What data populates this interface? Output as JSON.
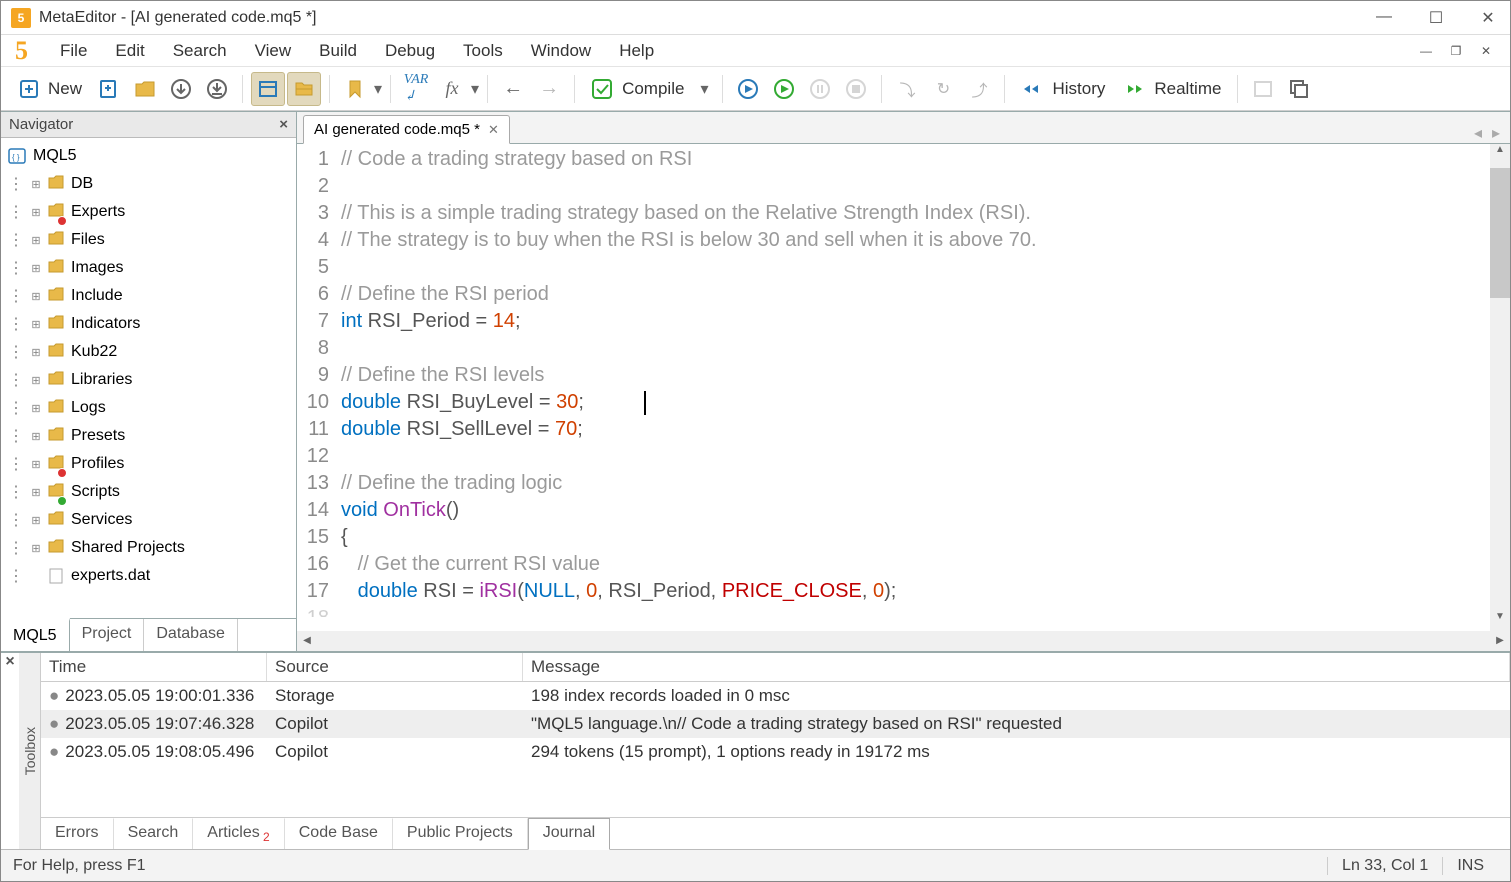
{
  "window": {
    "title": "MetaEditor - [AI generated code.mq5 *]"
  },
  "menu": {
    "items": [
      "File",
      "Edit",
      "Search",
      "View",
      "Build",
      "Debug",
      "Tools",
      "Window",
      "Help"
    ]
  },
  "toolbar": {
    "new_label": "New",
    "compile_label": "Compile",
    "history_label": "History",
    "realtime_label": "Realtime"
  },
  "navigator": {
    "title": "Navigator",
    "root": "MQL5",
    "items": [
      {
        "label": "DB",
        "overlay": ""
      },
      {
        "label": "Experts",
        "overlay": "red"
      },
      {
        "label": "Files",
        "overlay": ""
      },
      {
        "label": "Images",
        "overlay": ""
      },
      {
        "label": "Include",
        "overlay": ""
      },
      {
        "label": "Indicators",
        "overlay": ""
      },
      {
        "label": "Kub22",
        "overlay": ""
      },
      {
        "label": "Libraries",
        "overlay": ""
      },
      {
        "label": "Logs",
        "overlay": ""
      },
      {
        "label": "Presets",
        "overlay": ""
      },
      {
        "label": "Profiles",
        "overlay": "red"
      },
      {
        "label": "Scripts",
        "overlay": "green"
      },
      {
        "label": "Services",
        "overlay": ""
      },
      {
        "label": "Shared Projects",
        "overlay": ""
      }
    ],
    "file": "experts.dat",
    "tabs": [
      "MQL5",
      "Project",
      "Database"
    ],
    "active_tab": 0
  },
  "editor": {
    "tab_label": "AI generated code.mq5 *",
    "lines": [
      {
        "n": 1,
        "tokens": [
          {
            "t": "// Code a trading strategy based on RSI",
            "c": "cm"
          }
        ]
      },
      {
        "n": 2,
        "tokens": []
      },
      {
        "n": 3,
        "tokens": [
          {
            "t": "// This is a simple trading strategy based on the Relative Strength Index (RSI).",
            "c": "cm"
          }
        ]
      },
      {
        "n": 4,
        "tokens": [
          {
            "t": "// The strategy is to buy when the RSI is below 30 and sell when it is above 70.",
            "c": "cm"
          }
        ]
      },
      {
        "n": 5,
        "tokens": []
      },
      {
        "n": 6,
        "tokens": [
          {
            "t": "// Define the RSI period",
            "c": "cm"
          }
        ]
      },
      {
        "n": 7,
        "tokens": [
          {
            "t": "int",
            "c": "kw"
          },
          {
            "t": " RSI_Period = ",
            "c": ""
          },
          {
            "t": "14",
            "c": "num"
          },
          {
            "t": ";",
            "c": ""
          }
        ]
      },
      {
        "n": 8,
        "tokens": []
      },
      {
        "n": 9,
        "tokens": [
          {
            "t": "// Define the RSI levels",
            "c": "cm"
          }
        ]
      },
      {
        "n": 10,
        "tokens": [
          {
            "t": "double",
            "c": "kw"
          },
          {
            "t": " RSI_BuyLevel = ",
            "c": ""
          },
          {
            "t": "30",
            "c": "num"
          },
          {
            "t": ";",
            "c": ""
          }
        ]
      },
      {
        "n": 11,
        "tokens": [
          {
            "t": "double",
            "c": "kw"
          },
          {
            "t": " RSI_SellLevel = ",
            "c": ""
          },
          {
            "t": "70",
            "c": "num"
          },
          {
            "t": ";",
            "c": ""
          }
        ]
      },
      {
        "n": 12,
        "tokens": []
      },
      {
        "n": 13,
        "tokens": [
          {
            "t": "// Define the trading logic",
            "c": "cm"
          }
        ]
      },
      {
        "n": 14,
        "tokens": [
          {
            "t": "void",
            "c": "kw"
          },
          {
            "t": " ",
            "c": ""
          },
          {
            "t": "OnTick",
            "c": "fn"
          },
          {
            "t": "()",
            "c": ""
          }
        ]
      },
      {
        "n": 15,
        "tokens": [
          {
            "t": "{",
            "c": ""
          }
        ]
      },
      {
        "n": 16,
        "tokens": [
          {
            "t": "   ",
            "c": ""
          },
          {
            "t": "// Get the current RSI value",
            "c": "cm"
          }
        ]
      },
      {
        "n": 17,
        "tokens": [
          {
            "t": "   ",
            "c": ""
          },
          {
            "t": "double",
            "c": "kw"
          },
          {
            "t": " RSI = ",
            "c": ""
          },
          {
            "t": "iRSI",
            "c": "fn"
          },
          {
            "t": "(",
            "c": ""
          },
          {
            "t": "NULL",
            "c": "kw"
          },
          {
            "t": ", ",
            "c": ""
          },
          {
            "t": "0",
            "c": "num"
          },
          {
            "t": ", RSI_Period, ",
            "c": ""
          },
          {
            "t": "PRICE_CLOSE",
            "c": "const"
          },
          {
            "t": ", ",
            "c": ""
          },
          {
            "t": "0",
            "c": "num"
          },
          {
            "t": ");",
            "c": ""
          }
        ]
      }
    ]
  },
  "toolbox": {
    "label": "Toolbox",
    "headers": [
      "Time",
      "Source",
      "Message"
    ],
    "rows": [
      {
        "time": "2023.05.05 19:00:01.336",
        "source": "Storage",
        "msg": "198 index records loaded in 0 msc",
        "sel": false
      },
      {
        "time": "2023.05.05 19:07:46.328",
        "source": "Copilot",
        "msg": "\"MQL5 language.\\n// Code a trading strategy based on RSI\" requested",
        "sel": true
      },
      {
        "time": "2023.05.05 19:08:05.496",
        "source": "Copilot",
        "msg": "294 tokens (15 prompt), 1 options ready in 19172 ms",
        "sel": false
      }
    ],
    "tabs": [
      "Errors",
      "Search",
      "Articles",
      "Code Base",
      "Public Projects",
      "Journal"
    ],
    "articles_badge": "2",
    "active_tab": 5
  },
  "status": {
    "help": "For Help, press F1",
    "pos": "Ln 33, Col 1",
    "mode": "INS"
  }
}
